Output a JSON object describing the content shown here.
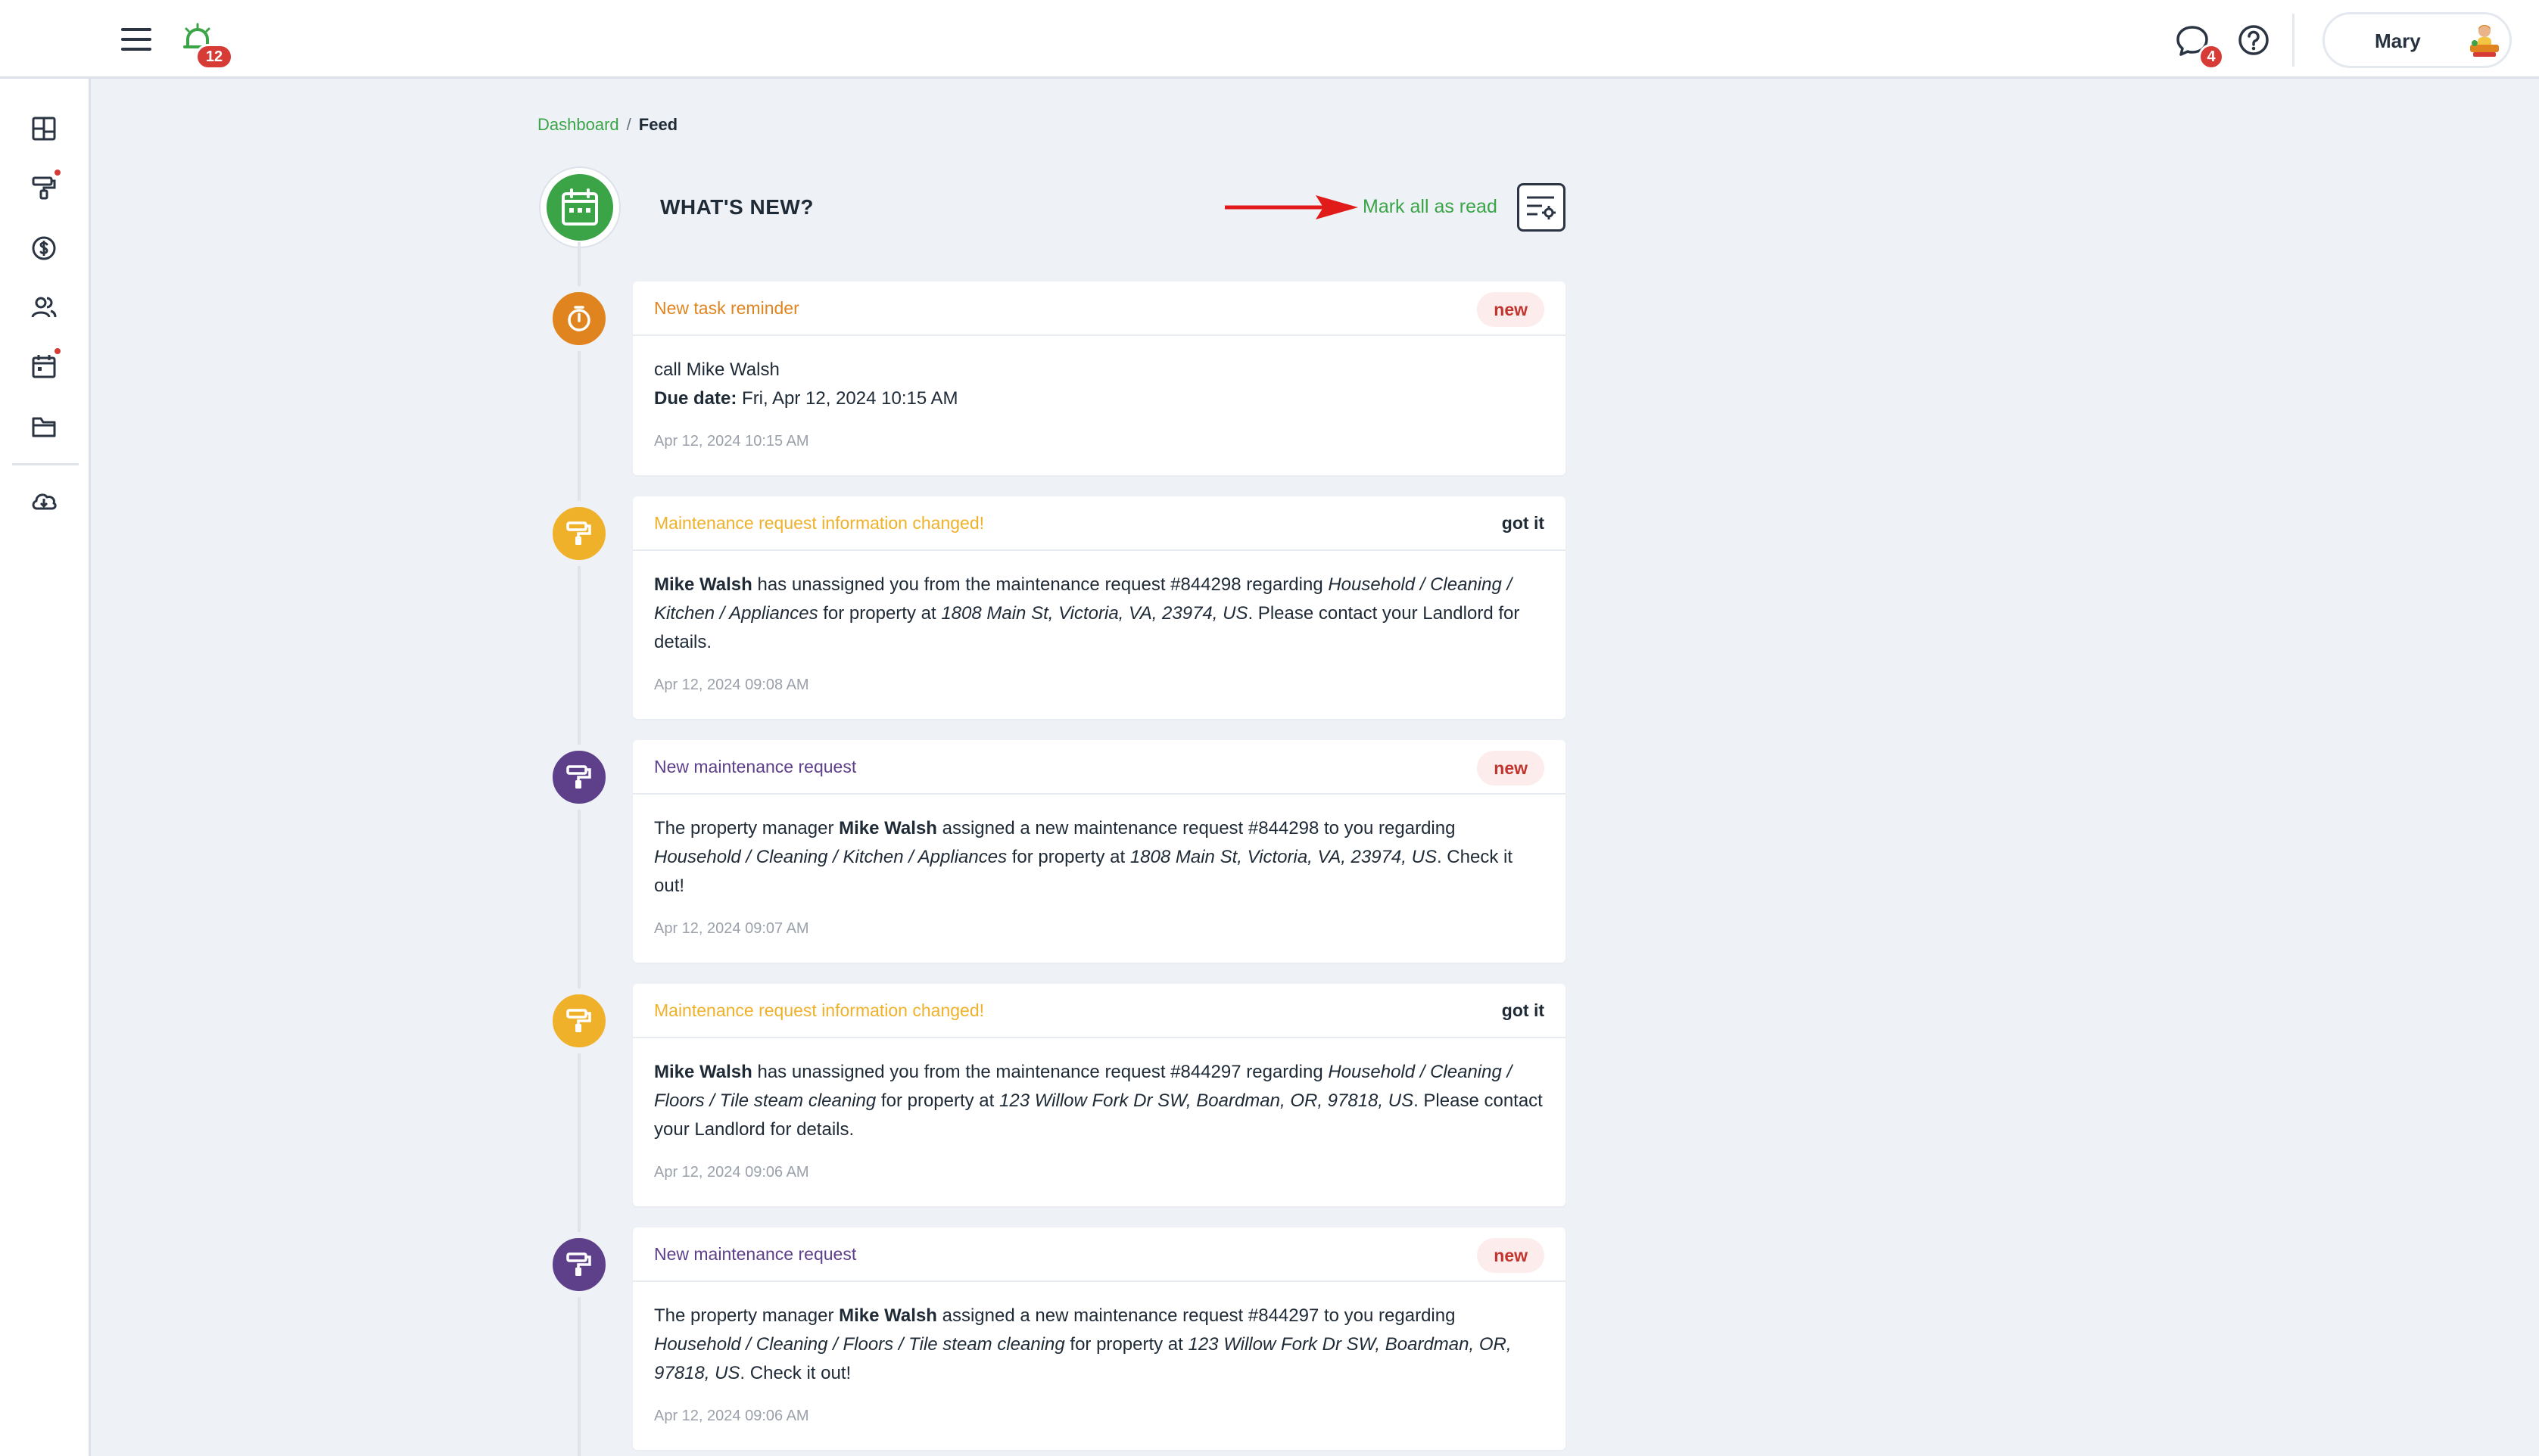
{
  "topbar": {
    "alarm_badge": "12",
    "messages_badge": "4",
    "user_name": "Mary"
  },
  "breadcrumb": {
    "root": "Dashboard",
    "separator": "/",
    "current": "Feed"
  },
  "feed_header": {
    "title": "WHAT'S NEW?",
    "mark_all_label": "Mark all as read"
  },
  "colors": {
    "accent_green": "#3aa447",
    "task_orange": "#e0841f",
    "maintenance_yellow": "#f0b12a",
    "maintenance_purple": "#5d3f8a",
    "badge_red": "#d63b36"
  },
  "feed": [
    {
      "title": "New task reminder",
      "status": "new",
      "line1": "call Mike Walsh",
      "due_label": "Due date:",
      "due_value": "Fri, Apr 12, 2024 10:15 AM",
      "date": "Apr 12, 2024 10:15 AM"
    },
    {
      "title": "Maintenance request information changed!",
      "status": "got it",
      "actor": "Mike Walsh",
      "text1": "has unassigned you from the maintenance request #844298 regarding",
      "category": "Household / Cleaning / Kitchen / Appliances",
      "text2": "for property at",
      "address": "1808 Main St, Victoria, VA, 23974, US",
      "text3": ". Please contact your Landlord for details.",
      "date": "Apr 12, 2024 09:08 AM"
    },
    {
      "title": "New maintenance request",
      "status": "new",
      "text0": "The property manager",
      "actor": "Mike Walsh",
      "text1": "assigned a new maintenance request #844298 to you regarding",
      "category": "Household / Cleaning / Kitchen / Appliances",
      "text2": "for property at",
      "address": "1808 Main St, Victoria, VA, 23974, US",
      "text3": ". Check it out!",
      "date": "Apr 12, 2024 09:07 AM"
    },
    {
      "title": "Maintenance request information changed!",
      "status": "got it",
      "actor": "Mike Walsh",
      "text1": "has unassigned you from the maintenance request #844297 regarding",
      "category": "Household / Cleaning / Floors / Tile steam cleaning",
      "text2": "for property at",
      "address": "123 Willow Fork Dr SW, Boardman, OR, 97818, US",
      "text3": ". Please contact your Landlord for details.",
      "date": "Apr 12, 2024 09:06 AM"
    },
    {
      "title": "New maintenance request",
      "status": "new",
      "text0": "The property manager",
      "actor": "Mike Walsh",
      "text1": "assigned a new maintenance request #844297 to you regarding",
      "category": "Household / Cleaning / Floors / Tile steam cleaning",
      "text2": "for property at",
      "address": "123 Willow Fork Dr SW, Boardman, OR, 97818, US",
      "text3": ". Check it out!",
      "date": "Apr 12, 2024 09:06 AM"
    }
  ]
}
